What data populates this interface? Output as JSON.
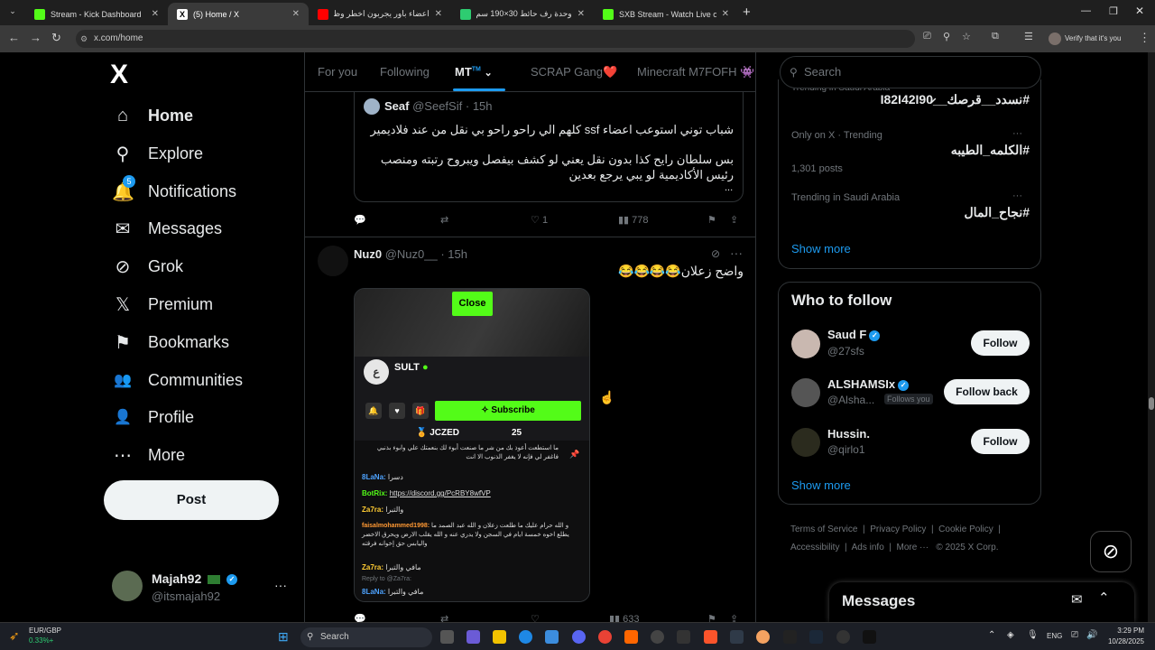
{
  "browser": {
    "tabs": [
      {
        "label": "Stream - Kick Dashboard",
        "color": "#53fc18"
      },
      {
        "label": "(5) Home / X",
        "color": "#ffffff"
      },
      {
        "label": "اعضاء باور يجربون اخطر وظيفة في",
        "color": "#ff0000"
      },
      {
        "label": "وحدة رف حائط 30×190 سم لون",
        "color": "#2ecc71"
      },
      {
        "label": "SXB Stream - Watch Live on Kick",
        "color": "#53fc18"
      }
    ],
    "url": "x.com/home",
    "profile_label": "Verify that it's you"
  },
  "sidebar": {
    "logo": "X",
    "items": [
      {
        "label": "Home",
        "icon": "home-icon",
        "glyph": "⌂"
      },
      {
        "label": "Explore",
        "icon": "search-icon",
        "glyph": "⚲"
      },
      {
        "label": "Notifications",
        "icon": "bell-icon",
        "glyph": "🔔",
        "badge": "5"
      },
      {
        "label": "Messages",
        "icon": "envelope-icon",
        "glyph": "✉"
      },
      {
        "label": "Grok",
        "icon": "grok-icon",
        "glyph": "⊘"
      },
      {
        "label": "Premium",
        "icon": "x-premium-icon",
        "glyph": "𝕏"
      },
      {
        "label": "Bookmarks",
        "icon": "bookmark-icon",
        "glyph": "⚑"
      },
      {
        "label": "Communities",
        "icon": "communities-icon",
        "glyph": "👥"
      },
      {
        "label": "Profile",
        "icon": "person-icon",
        "glyph": "👤"
      },
      {
        "label": "More",
        "icon": "more-circle-icon",
        "glyph": "⋯"
      }
    ],
    "post_label": "Post",
    "account": {
      "name": "Majah92",
      "handle": "@itsmajah92",
      "more": "···"
    }
  },
  "feed": {
    "tabs": [
      "For you",
      "Following",
      "MT",
      "SCRAP Gang❤️",
      "Minecraft M7FOFH 👾"
    ],
    "tab_superscript": "TM",
    "quote": {
      "name": "Seaf",
      "handle": "@SeefSif",
      "time": "15h",
      "line1": "شباب توني استوعب اعضاء ssf كلهم الي راحو راحو بي نقل  من عند فلاديمير",
      "line2": "بس سلطان رايح كذا بدون نقل يعني لو كشف بيفصل ويبروح رتبته ومنصب رئيس الأكاديمية لو يبي يرجع بعدين",
      "ellipsis": "..."
    },
    "post1_actions": {
      "replies": "",
      "reposts": "",
      "likes": "1",
      "views": "778"
    },
    "post2": {
      "name": "Nuz0",
      "handle": "@Nuz0__",
      "time": "15h",
      "text": "واضح زعلان😂😂😂😂",
      "views": "633"
    },
    "embed": {
      "close": "Close",
      "channel": "SULT",
      "subscribe": "Subscribe",
      "gifter": "JCZED",
      "gift_count": "25",
      "chat": [
        {
          "user": "",
          "text": "ما استطعت أعوذ بك من شر ما صنعت أبوء لك بنعمتك علي وابوء بذنبي فاغفر لي فإنه لا يغفر الذنوب الا انت",
          "color": "#dddddd"
        },
        {
          "user": "8LaNa:",
          "text": "دسرا",
          "color": "#4ea3ff"
        },
        {
          "user": "BotRix:",
          "text": "https://discord.gg/PcRBY8wfVP",
          "color": "#53fc18"
        },
        {
          "user": "Za7ra:",
          "text": "والتبرا",
          "color": "#ffcc33"
        },
        {
          "user": "faisalmohammed1998:",
          "text": "و الله حرام عليك ما طلعت زعلان و الله عبد الصمد ما يطلع اخوه خمسة ايام في السجن ولا يدري عنه و الله يقلب الارض ويحرق الاخضر واليابس حق إخوانه فرقته",
          "color": "#ff9933"
        },
        {
          "user": "Za7ra:",
          "text": "مافي والتبرا",
          "color": "#ffcc33"
        },
        {
          "user": "8LaNa:",
          "text": "مافي والتبرا",
          "color": "#4ea3ff"
        }
      ],
      "reply_to": "Reply to @Za7ra:"
    }
  },
  "right": {
    "search_placeholder": "Search",
    "trends": [
      {
        "context": "Trending in Saudi Arabia",
        "title": "#نسدد__قرصك__I82I42I90̷",
        "posts": ""
      },
      {
        "context": "Only on X · Trending",
        "title": "#الكلمه_الطيبه",
        "posts": "1,301 posts"
      },
      {
        "context": "Trending in Saudi Arabia",
        "title": "#نجاح_المال",
        "posts": ""
      }
    ],
    "show_more": "Show more",
    "wtf_title": "Who to follow",
    "wtf": [
      {
        "name": "Saud F",
        "handle": "@27sfs",
        "button": "Follow",
        "follows_you": "",
        "avatar_color": "#c9b8b0"
      },
      {
        "name": "ALSHAMSIx",
        "handle": "@Alsha...",
        "button": "Follow back",
        "follows_you": "Follows you",
        "avatar_color": "#555555"
      },
      {
        "name": "Hussin.",
        "handle": "@qirlo1",
        "button": "Follow",
        "follows_you": "",
        "avatar_color": "#2b2b1e"
      }
    ],
    "footer": [
      "Terms of Service",
      "Privacy Policy",
      "Cookie Policy",
      "Accessibility",
      "Ads info",
      "More ···",
      "© 2025 X Corp."
    ],
    "messages_title": "Messages"
  },
  "taskbar": {
    "ticker_pair": "EUR/GBP",
    "ticker_change": "0.33%+",
    "search_label": "Search",
    "lang": "ENG",
    "time": "3:29 PM",
    "date": "10/28/2025"
  }
}
